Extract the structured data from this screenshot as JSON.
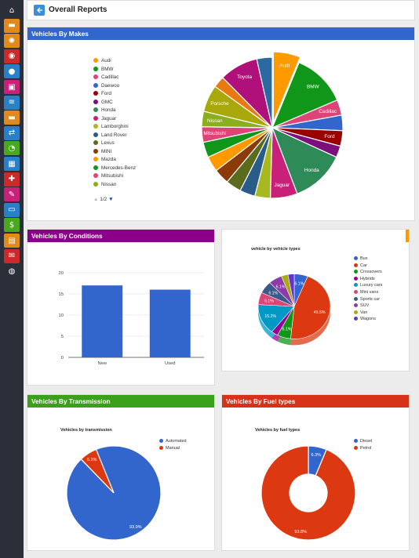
{
  "header": {
    "title": "Overall Reports"
  },
  "sidebar": {
    "items": [
      {
        "icon": "home-icon",
        "color": "#2b2f3a"
      },
      {
        "icon": "car-icon",
        "color": "#e08a1e"
      },
      {
        "icon": "settings-icon",
        "color": "#e08a1e"
      },
      {
        "icon": "vehicle-icon",
        "color": "#cc2a2a"
      },
      {
        "icon": "user-icon",
        "color": "#2a7fc9"
      },
      {
        "icon": "box-icon",
        "color": "#c9207a"
      },
      {
        "icon": "database-icon",
        "color": "#2a7fc9"
      },
      {
        "icon": "truck-icon",
        "color": "#e08a1e"
      },
      {
        "icon": "transfer-icon",
        "color": "#2a7fc9"
      },
      {
        "icon": "gauge-icon",
        "color": "#4aa81e"
      },
      {
        "icon": "calendar-icon",
        "color": "#2a7fc9"
      },
      {
        "icon": "repair-icon",
        "color": "#cc2a2a"
      },
      {
        "icon": "tools-icon",
        "color": "#c9207a"
      },
      {
        "icon": "bus-icon",
        "color": "#2a7fc9"
      },
      {
        "icon": "money-icon",
        "color": "#4aa81e"
      },
      {
        "icon": "report-icon",
        "color": "#e08a1e"
      },
      {
        "icon": "mail-icon",
        "color": "#cc2a2a"
      },
      {
        "icon": "globe-icon",
        "color": "#2b2f3a"
      }
    ]
  },
  "makes": {
    "title": "Vehicles By Makes",
    "head_color": "#3366cc",
    "pagination": "1/2",
    "chart_data": {
      "type": "pie",
      "legend": [
        "Audi",
        "BMW",
        "Cadillac",
        "Daewoo",
        "Ford",
        "GMC",
        "Honda",
        "Jaguar",
        "Lamborghini",
        "Land Rover",
        "Lexus",
        "MINI",
        "Mazda",
        "Mercedes-Benz",
        "Mitsubishi",
        "Nissan"
      ],
      "legend_colors": [
        "#ff9900",
        "#109618",
        "#dd4477",
        "#3366cc",
        "#990000",
        "#7b0f7b",
        "#2e8b57",
        "#c9207a",
        "#a8b820",
        "#2a5c8a",
        "#5a6b1e",
        "#8b3a0a",
        "#ff9900",
        "#109618",
        "#dd4477",
        "#8bae1c"
      ],
      "slices": [
        {
          "label": "Audi",
          "value": 7,
          "color": "#ff9900",
          "exploded": true
        },
        {
          "label": "BMW",
          "value": 14,
          "color": "#109618"
        },
        {
          "label": "Cadillac",
          "value": 4,
          "color": "#dd4477"
        },
        {
          "label": "",
          "value": 4,
          "color": "#3366cc"
        },
        {
          "label": "Ford",
          "value": 4,
          "color": "#990000"
        },
        {
          "label": "",
          "value": 3,
          "color": "#7b0f7b"
        },
        {
          "label": "Honda",
          "value": 14,
          "color": "#2e8b57"
        },
        {
          "label": "Jaguar",
          "value": 7,
          "color": "#c9207a"
        },
        {
          "label": "",
          "value": 4,
          "color": "#a8b820"
        },
        {
          "label": "",
          "value": 4,
          "color": "#2a5c8a"
        },
        {
          "label": "",
          "value": 4,
          "color": "#5a6b1e"
        },
        {
          "label": "",
          "value": 4,
          "color": "#8b3a0a"
        },
        {
          "label": "",
          "value": 4,
          "color": "#ff9900"
        },
        {
          "label": "",
          "value": 4,
          "color": "#109618"
        },
        {
          "label": "Mitsubishi",
          "value": 4,
          "color": "#dd4477"
        },
        {
          "label": "Nissan",
          "value": 4,
          "color": "#8bae1c"
        },
        {
          "label": "Porsche",
          "value": 7,
          "color": "#a8a80a"
        },
        {
          "label": "",
          "value": 3,
          "color": "#e87a10"
        },
        {
          "label": "Toyota",
          "value": 10,
          "color": "#b0107a"
        },
        {
          "label": "",
          "value": 4,
          "color": "#2a6aa0"
        }
      ]
    }
  },
  "conditions": {
    "title": "Vehicles By Conditions",
    "head_color": "#8b008b",
    "chart_data": {
      "type": "bar",
      "categories": [
        "New",
        "Used"
      ],
      "values": [
        17,
        16
      ],
      "ylim": [
        0,
        20
      ],
      "yticks": [
        0,
        5,
        10,
        15,
        20
      ],
      "color": "#3366cc"
    }
  },
  "vehicle_types": {
    "chart_title": "vehicle by vehicle types",
    "chart_data": {
      "type": "pie",
      "legend": [
        "Bus",
        "Car",
        "Crossovers",
        "Hybrids",
        "Luxury cars",
        "Mini vans",
        "Sports car",
        "SUV",
        "Van",
        "Wagons"
      ],
      "legend_colors": [
        "#3366cc",
        "#dc3912",
        "#109618",
        "#990099",
        "#0099c6",
        "#dd4477",
        "#3b5a8a",
        "#8e3aa8",
        "#aaaa11",
        "#6633cc"
      ],
      "slices": [
        {
          "label": "6.1%",
          "value": 6.1,
          "color": "#3366cc"
        },
        {
          "label": "45.5%",
          "value": 45.5,
          "color": "#dc3912"
        },
        {
          "label": "6.1%",
          "value": 6.1,
          "color": "#109618"
        },
        {
          "label": "",
          "value": 3.0,
          "color": "#990099"
        },
        {
          "label": "15.2%",
          "value": 15.2,
          "color": "#0099c6"
        },
        {
          "label": "6.1%",
          "value": 6.1,
          "color": "#dd4477"
        },
        {
          "label": "6.1%",
          "value": 6.1,
          "color": "#3b5a8a"
        },
        {
          "label": "6.1%",
          "value": 6.1,
          "color": "#8e3aa8"
        },
        {
          "label": "",
          "value": 3.0,
          "color": "#aaaa11"
        },
        {
          "label": "",
          "value": 2.8,
          "color": "#6633cc"
        }
      ]
    }
  },
  "transmission": {
    "title": "Vehicles By Transmission",
    "head_color": "#3aa01a",
    "chart_title": "Vehicles by transmission",
    "chart_data": {
      "type": "pie",
      "legend": [
        "Automated",
        "Manual"
      ],
      "legend_colors": [
        "#3366cc",
        "#dc3912"
      ],
      "slices": [
        {
          "label": "93.9%",
          "value": 93.9,
          "color": "#3366cc"
        },
        {
          "label": "6.1%",
          "value": 6.1,
          "color": "#dc3912"
        }
      ]
    }
  },
  "fuel": {
    "title": "Vehicles By Fuel types",
    "head_color": "#d6321a",
    "chart_title": "Vehicles by fuel types",
    "chart_data": {
      "type": "pie",
      "donut": true,
      "legend": [
        "Diesel",
        "Petrol"
      ],
      "legend_colors": [
        "#3366cc",
        "#dc3912"
      ],
      "slices": [
        {
          "label": "6.3%",
          "value": 6.3,
          "color": "#3366cc"
        },
        {
          "label": "93.8%",
          "value": 93.8,
          "color": "#dc3912"
        }
      ]
    }
  }
}
